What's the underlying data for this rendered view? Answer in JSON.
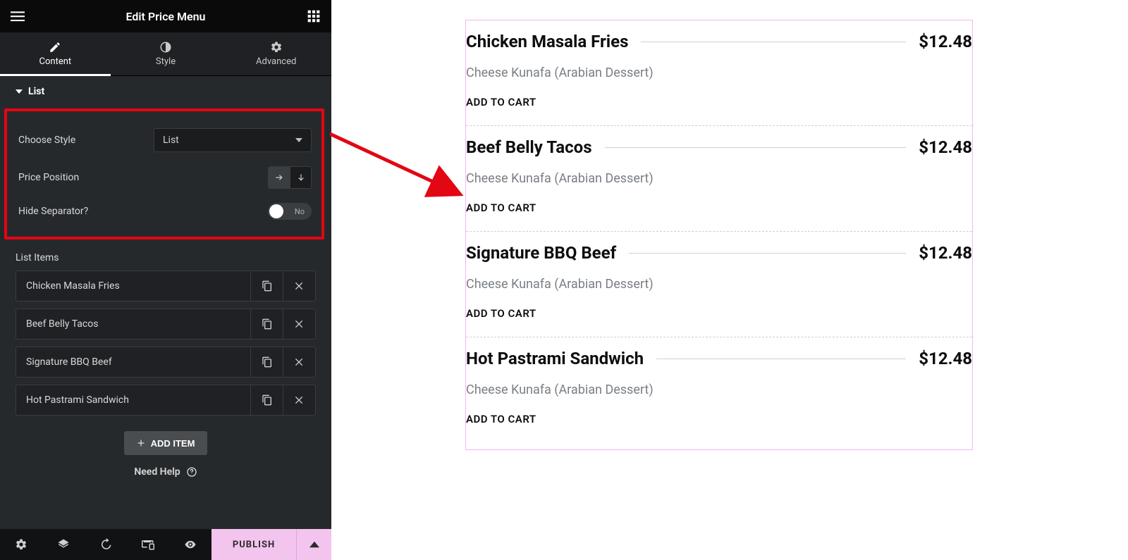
{
  "panel": {
    "title": "Edit Price Menu",
    "tabs": {
      "content": "Content",
      "style": "Style",
      "advanced": "Advanced"
    },
    "section_list": "List",
    "controls": {
      "choose_style_label": "Choose Style",
      "choose_style_value": "List",
      "price_position_label": "Price Position",
      "hide_separator_label": "Hide Separator?",
      "hide_separator_value": "No"
    },
    "list_items_label": "List Items",
    "items": [
      {
        "label": "Chicken Masala Fries"
      },
      {
        "label": "Beef Belly Tacos"
      },
      {
        "label": "Signature BBQ Beef"
      },
      {
        "label": "Hot Pastrami Sandwich"
      }
    ],
    "add_item": "ADD ITEM",
    "need_help": "Need Help",
    "publish": "PUBLISH"
  },
  "preview": {
    "items": [
      {
        "title": "Chicken Masala Fries",
        "price": "$12.48",
        "desc": "Cheese Kunafa (Arabian Dessert)",
        "cta": "ADD TO CART"
      },
      {
        "title": "Beef Belly Tacos",
        "price": "$12.48",
        "desc": "Cheese Kunafa (Arabian Dessert)",
        "cta": "ADD TO CART"
      },
      {
        "title": "Signature BBQ Beef",
        "price": "$12.48",
        "desc": "Cheese Kunafa (Arabian Dessert)",
        "cta": "ADD TO CART"
      },
      {
        "title": "Hot Pastrami Sandwich",
        "price": "$12.48",
        "desc": "Cheese Kunafa (Arabian Dessert)",
        "cta": "ADD TO CART"
      }
    ]
  },
  "colors": {
    "highlight": "#e30613",
    "accent": "#f2c4ee"
  }
}
